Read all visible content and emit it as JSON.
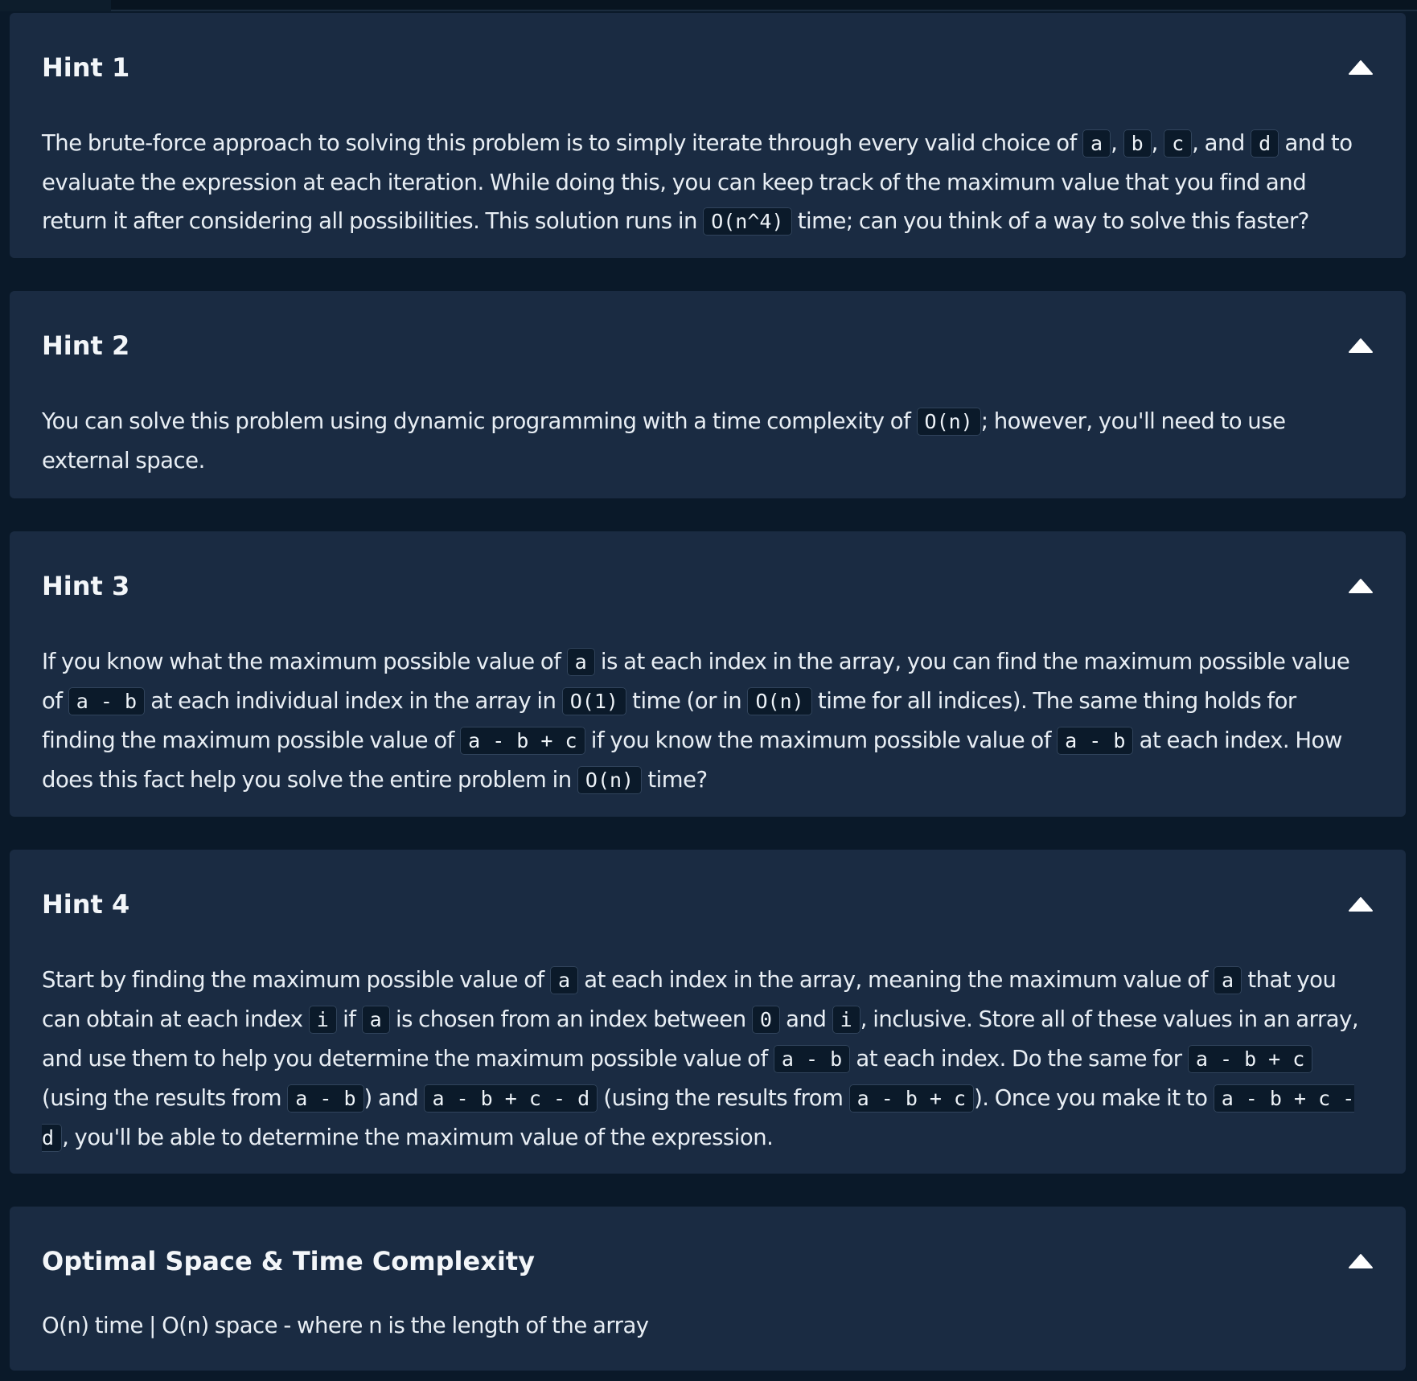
{
  "panels": [
    {
      "title": "Hint 1",
      "paragraph": [
        {
          "t": "The brute-force approach to solving this problem is to simply iterate through every valid choice of "
        },
        {
          "c": "a"
        },
        {
          "t": ", "
        },
        {
          "c": "b"
        },
        {
          "t": ", "
        },
        {
          "c": "c"
        },
        {
          "t": ", and "
        },
        {
          "c": "d"
        },
        {
          "t": " and to evaluate the expression at each iteration. While doing this, you can keep track of the maximum value that you find and return it after considering all possibilities. This solution runs in "
        },
        {
          "c": "O(n^4)"
        },
        {
          "t": " time; can you think of a way to solve this faster?"
        }
      ]
    },
    {
      "title": "Hint 2",
      "paragraph": [
        {
          "t": "You can solve this problem using dynamic programming with a time complexity of "
        },
        {
          "c": "O(n)"
        },
        {
          "t": "; however, you'll need to use external space."
        }
      ]
    },
    {
      "title": "Hint 3",
      "paragraph": [
        {
          "t": "If you know what the maximum possible value of "
        },
        {
          "c": "a"
        },
        {
          "t": " is at each index in the array, you can find the maximum possible value of "
        },
        {
          "c": "a - b"
        },
        {
          "t": " at each individual index in the array in "
        },
        {
          "c": "O(1)"
        },
        {
          "t": " time (or in "
        },
        {
          "c": "O(n)"
        },
        {
          "t": " time for all indices). The same thing holds for finding the maximum possible value of "
        },
        {
          "c": "a - b + c"
        },
        {
          "t": " if you know the maximum possible value of "
        },
        {
          "c": "a - b"
        },
        {
          "t": " at each index. How does this fact help you solve the entire problem in "
        },
        {
          "c": "O(n)"
        },
        {
          "t": " time?"
        }
      ]
    },
    {
      "title": "Hint 4",
      "paragraph": [
        {
          "t": "Start by finding the maximum possible value of "
        },
        {
          "c": "a"
        },
        {
          "t": " at each index in the array, meaning the maximum value of "
        },
        {
          "c": "a"
        },
        {
          "t": " that you can obtain at each index "
        },
        {
          "c": "i"
        },
        {
          "t": " if "
        },
        {
          "c": "a"
        },
        {
          "t": " is chosen from an index between "
        },
        {
          "c": "0"
        },
        {
          "t": " and "
        },
        {
          "c": "i"
        },
        {
          "t": ", inclusive. Store all of these values in an array, and use them to help you determine the maximum possible value of "
        },
        {
          "c": "a - b"
        },
        {
          "t": " at each index. Do the same for "
        },
        {
          "c": "a - b + c"
        },
        {
          "t": " (using the results from "
        },
        {
          "c": "a - b"
        },
        {
          "t": ") and "
        },
        {
          "c": "a - b + c - d"
        },
        {
          "t": " (using the results from "
        },
        {
          "c": "a - b + c"
        },
        {
          "t": "). Once you make it to "
        },
        {
          "c": "a - b + c - d"
        },
        {
          "t": ", you'll be able to determine the maximum value of the expression."
        }
      ]
    },
    {
      "title": "Optimal Space & Time Complexity",
      "paragraph": [
        {
          "t": "O(n) time | O(n) space - where n is the length of the array"
        }
      ]
    }
  ],
  "icons": {
    "collapse": "chevron-up-icon"
  },
  "colors": {
    "page_background": "#0a1929",
    "panel_background": "#1a2b42",
    "code_background": "#0b1a2a",
    "code_border": "#31445c",
    "text": "#e8eef4"
  }
}
